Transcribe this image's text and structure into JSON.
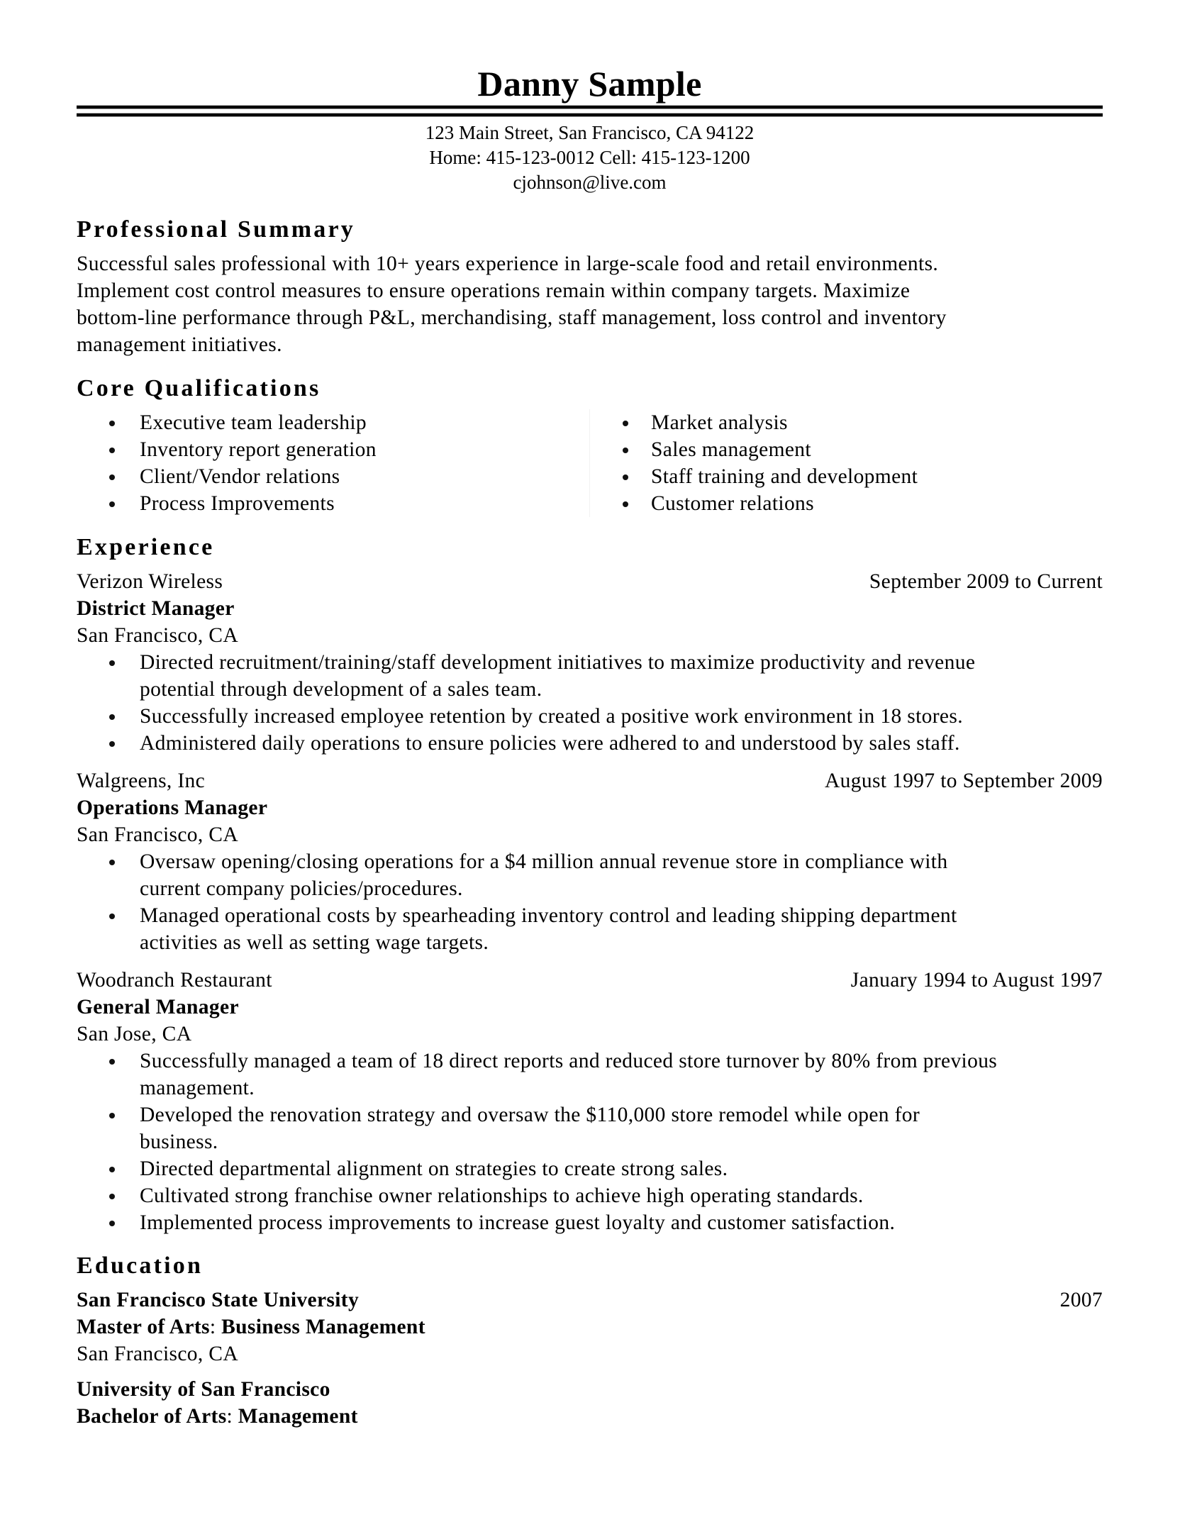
{
  "header": {
    "name": "Danny Sample",
    "address": "123 Main Street, San Francisco, CA 94122",
    "phones": "Home: 415-123-0012 Cell: 415-123-1200",
    "email": "cjohnson@live.com"
  },
  "summary": {
    "title": "Professional Summary",
    "lines": [
      "Successful sales professional with 10+ years experience in large-scale food and retail environments.",
      "Implement cost control measures to ensure operations remain within company targets. Maximize",
      "bottom-line performance through P&L, merchandising, staff management, loss control and inventory",
      "management initiatives."
    ]
  },
  "qualifications": {
    "title": "Core Qualifications",
    "left": [
      "Executive team leadership",
      "Inventory report generation",
      "Client/Vendor relations",
      "Process Improvements"
    ],
    "right": [
      "Market analysis",
      "Sales management",
      "Staff training and development",
      "Customer relations"
    ]
  },
  "experience": {
    "title": "Experience",
    "jobs": [
      {
        "company": "Verizon Wireless",
        "dates": "September 2009 to Current",
        "title": "District Manager",
        "location": "San Francisco, CA",
        "bullets": [
          [
            "Directed recruitment/training/staff development initiatives to maximize productivity and revenue",
            "potential through development of a sales team."
          ],
          [
            "Successfully increased employee retention by created a positive work environment in 18 stores."
          ],
          [
            "Administered daily operations to ensure policies were adhered to and understood by sales staff."
          ]
        ]
      },
      {
        "company": "Walgreens, Inc",
        "dates": "August 1997 to September 2009",
        "title": "Operations Manager",
        "location": "San Francisco, CA",
        "bullets": [
          [
            "Oversaw opening/closing operations for a $4 million annual revenue store in compliance with",
            "current company policies/procedures."
          ],
          [
            "Managed operational costs by spearheading inventory control and leading shipping department",
            "activities as well as setting wage targets."
          ]
        ]
      },
      {
        "company": "Woodranch Restaurant",
        "dates": "January 1994 to August 1997",
        "title": "General Manager",
        "location": "San Jose, CA",
        "bullets": [
          [
            "Successfully managed a team of 18 direct reports and reduced store turnover by 80% from previous",
            "management."
          ],
          [
            "Developed the renovation strategy and oversaw the $110,000 store remodel while open for",
            "business."
          ],
          [
            "Directed departmental alignment on strategies to create strong sales."
          ],
          [
            "Cultivated strong franchise owner relationships to achieve high operating standards."
          ],
          [
            "Implemented process improvements to increase guest loyalty and customer satisfaction."
          ]
        ]
      }
    ]
  },
  "education": {
    "title": "Education",
    "entries": [
      {
        "school": "San Francisco State University",
        "year": "2007",
        "degree": "Master of Arts",
        "colon": ":",
        "major": " Business Management",
        "location": "San Francisco, CA"
      },
      {
        "school": "University of San Francisco",
        "degree": "Bachelor of Arts",
        "colon": ":",
        "major": " Management"
      }
    ]
  }
}
